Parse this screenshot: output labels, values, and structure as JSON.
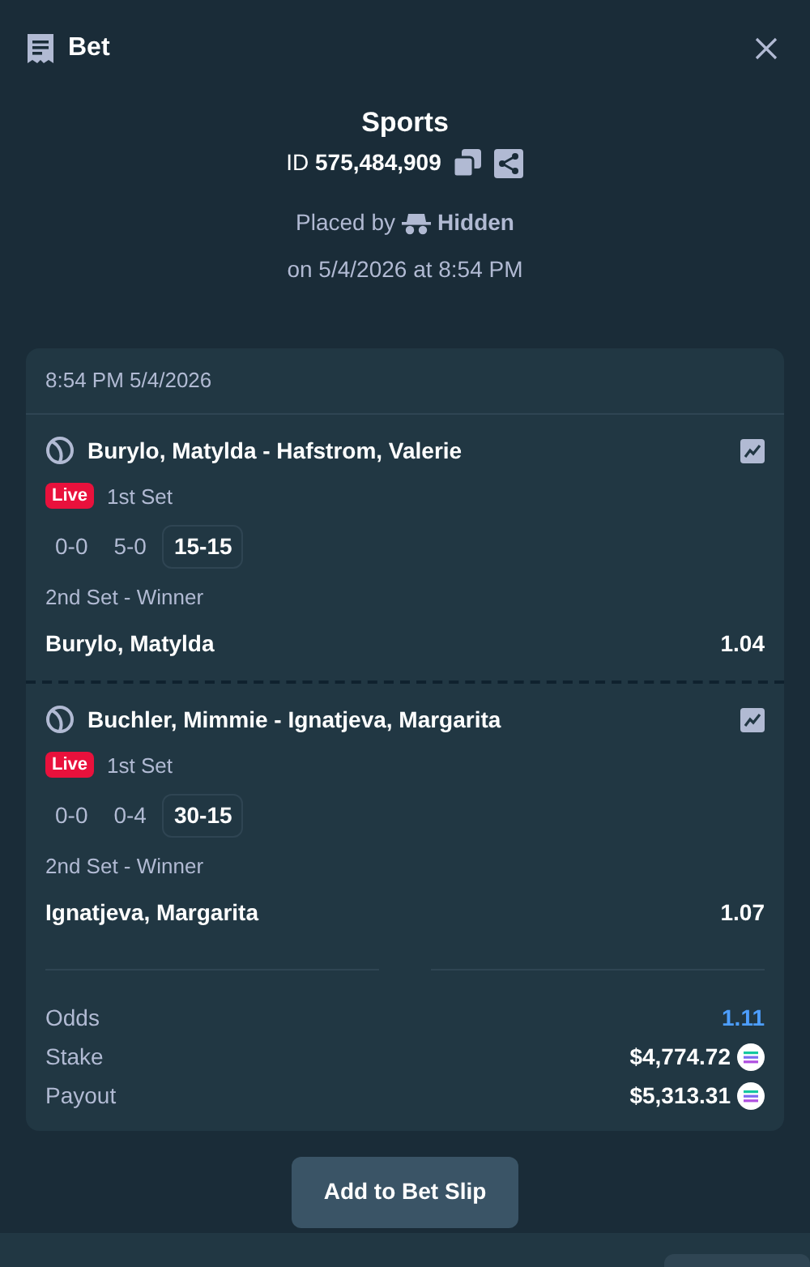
{
  "header": {
    "title": "Bet"
  },
  "summary": {
    "title": "Sports",
    "id_label": "ID",
    "id_value": "575,484,909",
    "placed_by_label": "Placed by",
    "placed_by_user": "Hidden",
    "placed_on": "on 5/4/2026 at 8:54 PM"
  },
  "card": {
    "timestamp": "8:54 PM 5/4/2026",
    "legs": [
      {
        "match": "Burylo, Matylda - Hafstrom, Valerie",
        "live_badge": "Live",
        "period": "1st Set",
        "scores": [
          {
            "text": "0-0",
            "current": false
          },
          {
            "text": "5-0",
            "current": false
          },
          {
            "text": "15-15",
            "current": true
          }
        ],
        "market": "2nd Set - Winner",
        "selection": "Burylo, Matylda",
        "odds": "1.04"
      },
      {
        "match": "Buchler, Mimmie - Ignatjeva, Margarita",
        "live_badge": "Live",
        "period": "1st Set",
        "scores": [
          {
            "text": "0-0",
            "current": false
          },
          {
            "text": "0-4",
            "current": false
          },
          {
            "text": "30-15",
            "current": true
          }
        ],
        "market": "2nd Set - Winner",
        "selection": "Ignatjeva, Margarita",
        "odds": "1.07"
      }
    ],
    "totals": [
      {
        "label": "Odds",
        "value": "1.11",
        "kind": "odds"
      },
      {
        "label": "Stake",
        "value": "$4,774.72",
        "kind": "currency"
      },
      {
        "label": "Payout",
        "value": "$5,313.31",
        "kind": "currency"
      }
    ]
  },
  "action_button": "Add to Bet Slip"
}
